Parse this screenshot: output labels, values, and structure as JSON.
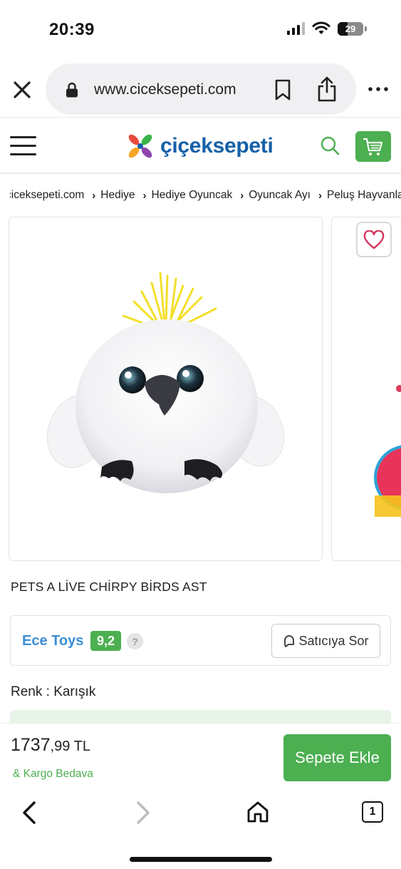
{
  "status_bar": {
    "time": "20:39",
    "battery": "29"
  },
  "browser": {
    "url": "www.ciceksepeti.com",
    "tab_count": "1",
    "icons": [
      "close-icon",
      "lock-icon",
      "bookmark-icon",
      "share-icon",
      "more-icon",
      "back-icon",
      "forward-icon",
      "home-icon",
      "tabs-icon"
    ]
  },
  "site": {
    "logo_text": "çiçeksepeti",
    "brand_color": "#1560a8",
    "accent_color": "#4caf50"
  },
  "breadcrumb": [
    "ciceksepeti.com",
    "Hediye",
    "Hediye Oyuncak",
    "Oyuncak Ayı",
    "Peluş Hayvanlar"
  ],
  "product": {
    "title": "PETS A LİVE CHİRPY BİRDS AST",
    "color_label": "Renk : Karışık"
  },
  "seller": {
    "name": "Ece Toys",
    "score": "9,2",
    "help": "?",
    "ask_label": "Satıcıya Sor"
  },
  "purchase": {
    "price_main": "1737",
    "price_decimal": ",99",
    "currency": "TL",
    "shipping": "& Kargo Bedava",
    "add_to_cart": "Sepete Ekle"
  }
}
